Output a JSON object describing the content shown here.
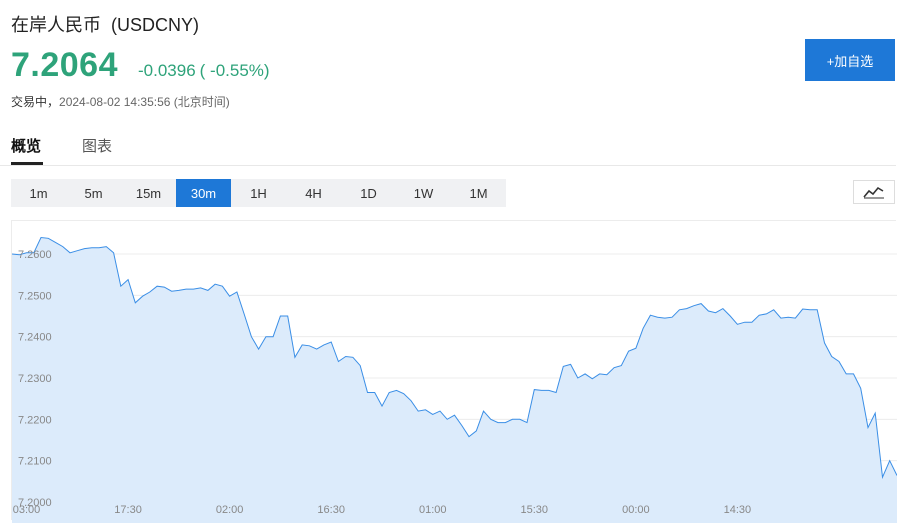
{
  "header": {
    "title": "在岸人民币  (USDCNY)",
    "price": "7.2064",
    "change": "-0.0396",
    "change_pct": "( -0.55%)",
    "status": "交易中",
    "timestamp": "2024-08-02 14:35:56 (北京时间)",
    "add_button": "+加自选"
  },
  "colors": {
    "price_down": "#2ea37a",
    "accent": "#1e78d7",
    "line": "#3a8ee6",
    "fill": "#dcebfb"
  },
  "tabs": [
    {
      "label": "概览",
      "active": true
    },
    {
      "label": "图表",
      "active": false
    }
  ],
  "periods": [
    {
      "label": "1m",
      "active": false
    },
    {
      "label": "5m",
      "active": false
    },
    {
      "label": "15m",
      "active": false
    },
    {
      "label": "30m",
      "active": true
    },
    {
      "label": "1H",
      "active": false
    },
    {
      "label": "4H",
      "active": false
    },
    {
      "label": "1D",
      "active": false
    },
    {
      "label": "1W",
      "active": false
    },
    {
      "label": "1M",
      "active": false
    }
  ],
  "chart_type_icon": "line-chart-icon",
  "chart_data": {
    "type": "area",
    "title": "",
    "xlabel": "",
    "ylabel": "",
    "ylim": [
      7.2,
      7.265
    ],
    "y_ticks": [
      "7.2600",
      "7.2500",
      "7.2400",
      "7.2300",
      "7.2200",
      "7.2100",
      "7.2000"
    ],
    "x_ticks": [
      "03:00",
      "17:30",
      "02:00",
      "16:30",
      "01:00",
      "15:30",
      "00:00",
      "14:30"
    ],
    "x_tick_index": [
      2,
      16,
      30,
      44,
      58,
      72,
      86,
      100
    ],
    "grid": true,
    "values": [
      7.26,
      7.2598,
      7.2603,
      7.2603,
      7.264,
      7.2638,
      7.2628,
      7.2618,
      7.2603,
      7.2608,
      7.2613,
      7.2615,
      7.2615,
      7.2618,
      7.2603,
      7.2522,
      7.2538,
      7.2482,
      7.2498,
      7.2508,
      7.2522,
      7.252,
      7.251,
      7.2512,
      7.2515,
      7.2515,
      7.2518,
      7.2512,
      7.2527,
      7.2522,
      7.2498,
      7.2508,
      7.2455,
      7.24,
      7.237,
      7.24,
      7.24,
      7.245,
      7.245,
      7.235,
      7.238,
      7.2378,
      7.237,
      7.238,
      7.2387,
      7.234,
      7.2352,
      7.235,
      7.233,
      7.2265,
      7.2265,
      7.2232,
      7.2265,
      7.227,
      7.2262,
      7.2245,
      7.222,
      7.2223,
      7.2212,
      7.222,
      7.22,
      7.221,
      7.2185,
      7.2158,
      7.2172,
      7.222,
      7.22,
      7.2192,
      7.2192,
      7.22,
      7.22,
      7.2192,
      7.2272,
      7.227,
      7.227,
      7.2265,
      7.2328,
      7.2333,
      7.23,
      7.231,
      7.2298,
      7.231,
      7.2308,
      7.2325,
      7.233,
      7.2365,
      7.2372,
      7.242,
      7.2452,
      7.2447,
      7.2445,
      7.2447,
      7.2465,
      7.2468,
      7.2475,
      7.248,
      7.2462,
      7.2458,
      7.2468,
      7.245,
      7.243,
      7.2435,
      7.2435,
      7.2452,
      7.2455,
      7.2465,
      7.2445,
      7.2447,
      7.2445,
      7.2467,
      7.2465,
      7.2465,
      7.2385,
      7.2352,
      7.234,
      7.231,
      7.231,
      7.2275,
      7.218,
      7.2215,
      7.206,
      7.21,
      7.2064
    ]
  }
}
